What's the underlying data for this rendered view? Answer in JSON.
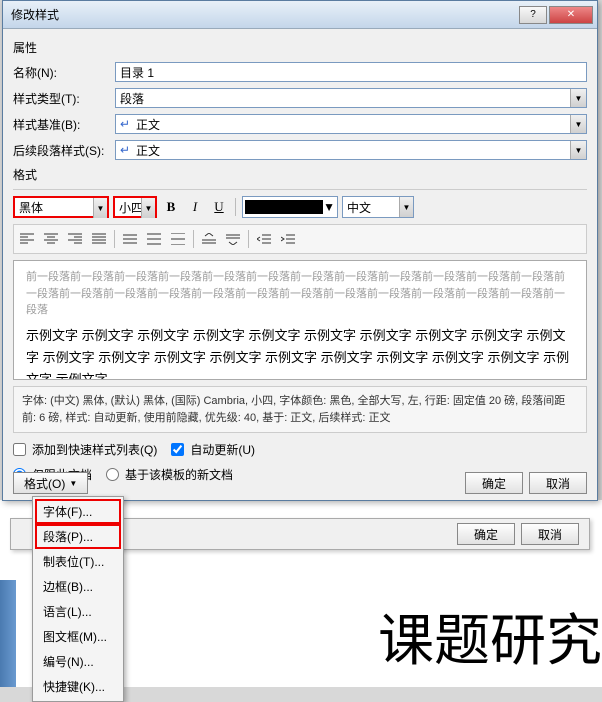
{
  "window": {
    "title": "修改样式"
  },
  "properties": {
    "group": "属性",
    "name_label": "名称(N):",
    "name_value": "目录 1",
    "type_label": "样式类型(T):",
    "type_value": "段落",
    "based_label": "样式基准(B):",
    "based_value": "正文",
    "follow_label": "后续段落样式(S):",
    "follow_value": "正文"
  },
  "format": {
    "group": "格式",
    "font": "黑体",
    "size": "小四",
    "lang": "中文",
    "bold": "B",
    "italic": "I",
    "underline": "U"
  },
  "preview": {
    "grey": "前一段落前一段落前一段落前一段落前一段落前一段落前一段落前一段落前一段落前一段落前一段落前一段落前一段落前一段落前一段落前一段落前一段落前一段落前一段落前一段落前一段落前一段落前一段落前一段落前一段落",
    "sample": "示例文字 示例文字 示例文字 示例文字 示例文字 示例文字 示例文字 示例文字 示例文字 示例文字 示例文字 示例文字 示例文字 示例文字 示例文字 示例文字 示例文字 示例文字 示例文字 示例文字 示例文字"
  },
  "description": "字体: (中文) 黑体, (默认) 黑体, (国际) Cambria, 小四, 字体颜色: 黑色, 全部大写, 左, 行距: 固定值 20 磅, 段落间距前: 6 磅, 样式: 自动更新, 使用前隐藏, 优先级: 40, 基于: 正文, 后续样式: 正文",
  "options": {
    "add_quick": "添加到快速样式列表(Q)",
    "auto_update": "自动更新(U)",
    "only_doc": "仅限此文档",
    "based_template": "基于该模板的新文档"
  },
  "buttons": {
    "format_menu": "格式(O)",
    "ok": "确定",
    "cancel": "取消"
  },
  "menu": {
    "font": "字体(F)...",
    "paragraph": "段落(P)...",
    "tabs": "制表位(T)...",
    "border": "边框(B)...",
    "language": "语言(L)...",
    "frame": "图文框(M)...",
    "numbering": "编号(N)...",
    "shortcut": "快捷键(K)..."
  },
  "doc": {
    "title": "课题研究"
  }
}
